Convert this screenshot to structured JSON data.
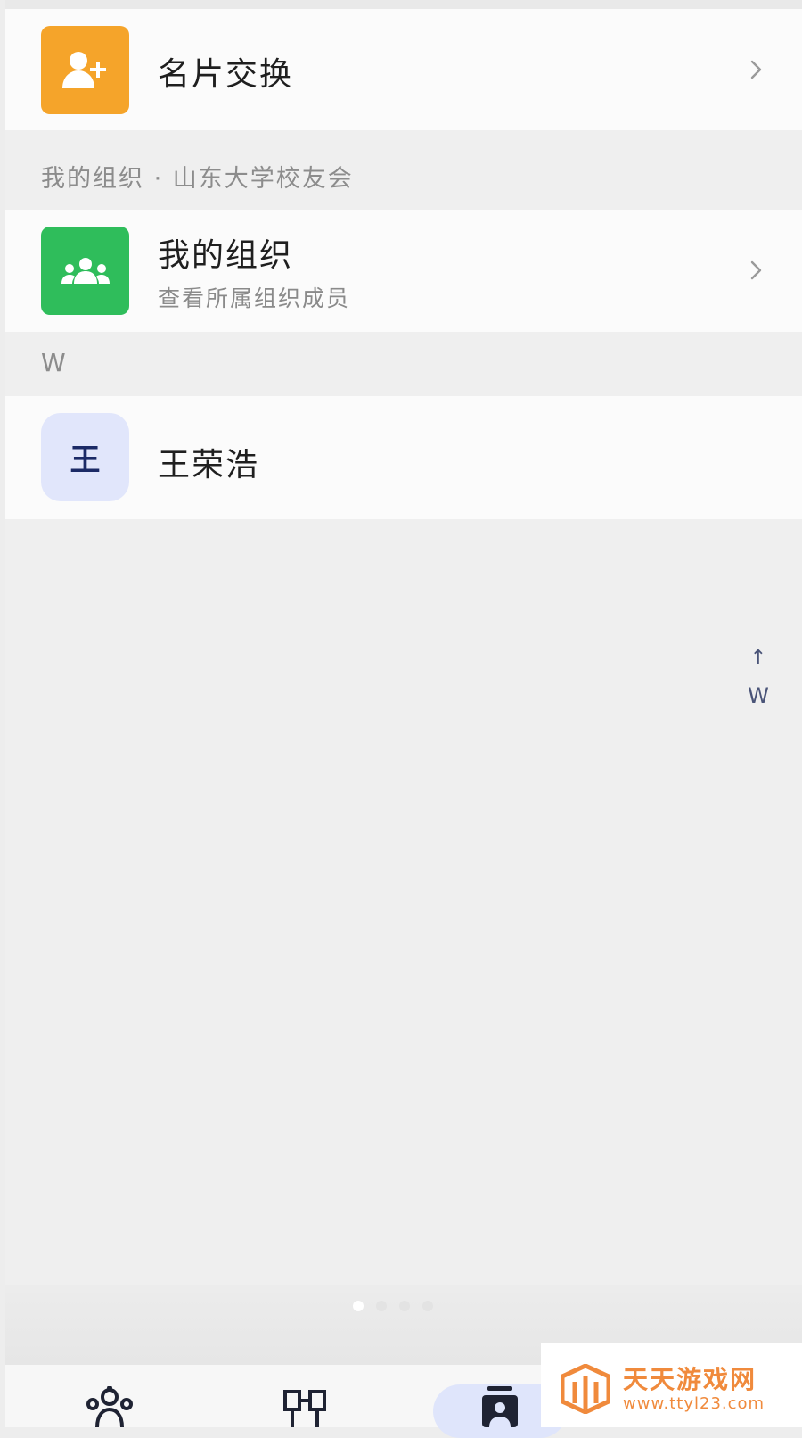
{
  "list": {
    "card_exchange": {
      "title": "名片交换",
      "icon": "add-user-icon"
    },
    "org_section_header": "我的组织 · 山东大学校友会",
    "my_org": {
      "title": "我的组织",
      "subtitle": "查看所属组织成员",
      "icon": "group-icon"
    },
    "letter_header": "W",
    "contacts": [
      {
        "avatar_letter": "王",
        "name": "王荣浩"
      }
    ]
  },
  "index_bar": {
    "arrow": "↑",
    "letters": [
      "W"
    ]
  },
  "tabbar": {
    "tabs": [
      {
        "icon": "members-icon",
        "active": false
      },
      {
        "icon": "org-structure-icon",
        "active": false
      },
      {
        "icon": "contacts-icon",
        "active": true
      }
    ]
  },
  "watermark": {
    "title": "天天游戏网",
    "url": "www.ttyl23.com"
  },
  "colors": {
    "orange_tile": "#f5a42a",
    "green_tile": "#2fbd5b",
    "avatar_bg": "#e1e6fb",
    "watermark": "#f08a3c"
  }
}
